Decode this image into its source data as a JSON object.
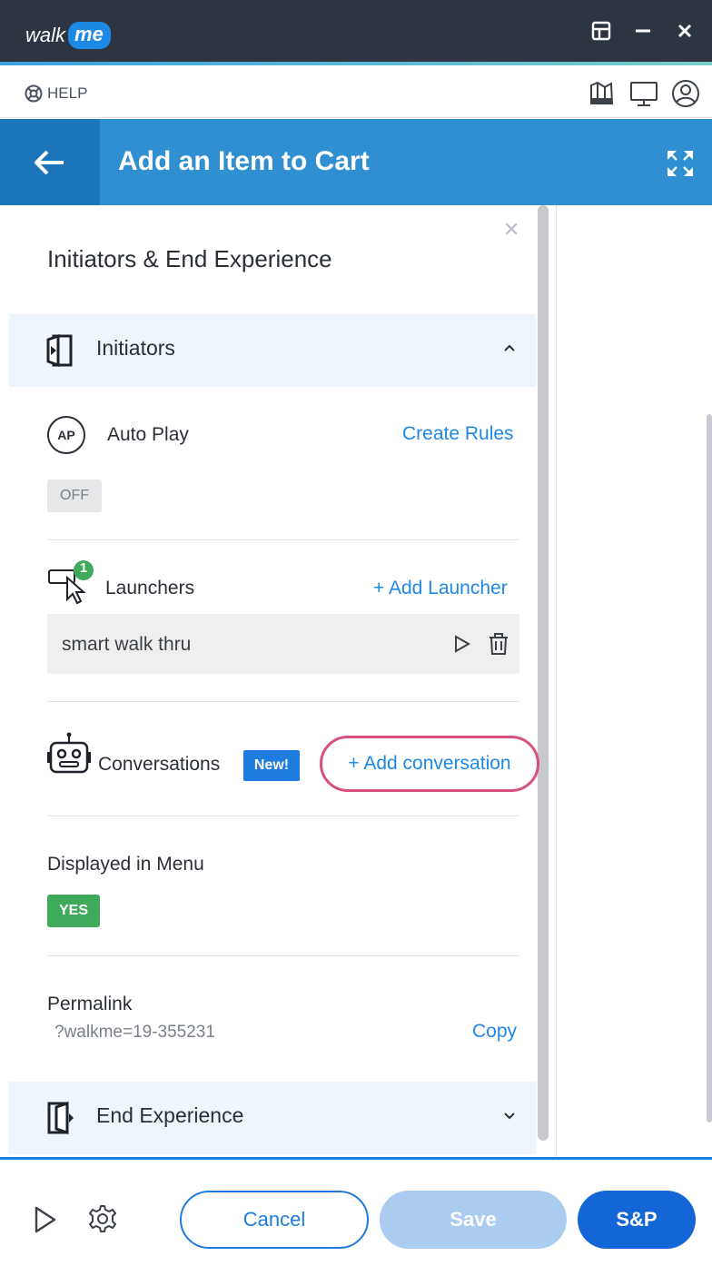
{
  "window": {
    "logo_walk": "walk",
    "logo_me": "me",
    "controls": [
      "layout-icon",
      "minimize-icon",
      "close-icon"
    ]
  },
  "helpbar": {
    "help_label": "HELP",
    "icons": [
      "palette-icon",
      "monitor-icon",
      "account-icon"
    ]
  },
  "header": {
    "title": "Add an Item to Cart"
  },
  "panel": {
    "title": "Initiators & End Experience",
    "initiators": {
      "label": "Initiators",
      "auto_play": {
        "badge": "AP",
        "label": "Auto Play",
        "link": "Create Rules",
        "status": "OFF"
      },
      "launchers": {
        "label": "Launchers",
        "count": "1",
        "link": "+ Add Launcher",
        "items": [
          {
            "name": "smart walk thru"
          }
        ]
      },
      "conversations": {
        "label": "Conversations",
        "badge": "New!",
        "link": "+ Add conversation"
      }
    },
    "displayed_in_menu": {
      "label": "Displayed in Menu",
      "status": "YES"
    },
    "permalink": {
      "label": "Permalink",
      "value": "?walkme=19-355231",
      "link": "Copy"
    },
    "end_experience": {
      "label": "End Experience"
    }
  },
  "footer": {
    "cancel": "Cancel",
    "save": "Save",
    "sp": "S&P"
  },
  "colors": {
    "titlebar": "#2d3542",
    "header": "#2f8fd0",
    "back": "#1c75b8",
    "link": "#1e88e5",
    "highlight": "#d94f80",
    "yes": "#3faa5a",
    "primary": "#1465d6"
  }
}
